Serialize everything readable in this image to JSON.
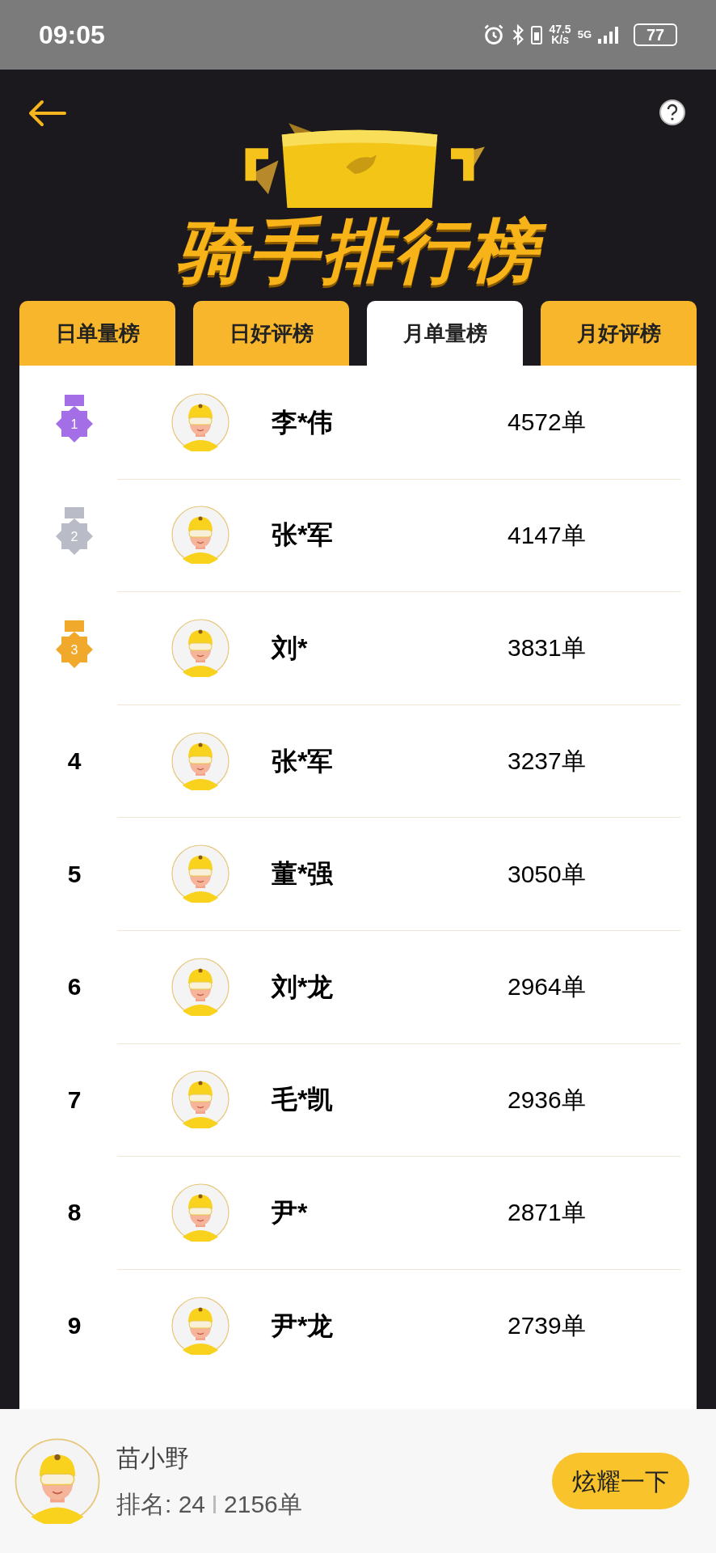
{
  "status_bar": {
    "time": "09:05",
    "speed_value": "47.5",
    "speed_unit": "K/s",
    "network": "5G",
    "battery": "77"
  },
  "header": {
    "title": "骑手排行榜"
  },
  "tabs": [
    {
      "label": "日单量榜",
      "selected": false
    },
    {
      "label": "日好评榜",
      "selected": false
    },
    {
      "label": "月单量榜",
      "selected": true
    },
    {
      "label": "月好评榜",
      "selected": false
    }
  ],
  "rows": [
    {
      "kind": "medal",
      "rank": "1",
      "color": "#a46ee6",
      "name": "李*伟",
      "orders": "4572单"
    },
    {
      "kind": "medal",
      "rank": "2",
      "color": "#b9bcc6",
      "name": "张*军",
      "orders": "4147单"
    },
    {
      "kind": "medal",
      "rank": "3",
      "color": "#f0a92a",
      "name": "刘*",
      "orders": "3831单"
    },
    {
      "kind": "number",
      "rank": "4",
      "name": "张*军",
      "orders": "3237单"
    },
    {
      "kind": "number",
      "rank": "5",
      "name": "董*强",
      "orders": "3050单"
    },
    {
      "kind": "number",
      "rank": "6",
      "name": "刘*龙",
      "orders": "2964单"
    },
    {
      "kind": "number",
      "rank": "7",
      "name": "毛*凯",
      "orders": "2936单"
    },
    {
      "kind": "number",
      "rank": "8",
      "name": "尹*",
      "orders": "2871单"
    },
    {
      "kind": "number",
      "rank": "9",
      "name": "尹*龙",
      "orders": "2739单"
    }
  ],
  "my_rank": {
    "name": "苗小野",
    "rank": "排名: 24",
    "orders": "2156单",
    "button": "炫耀一下"
  }
}
